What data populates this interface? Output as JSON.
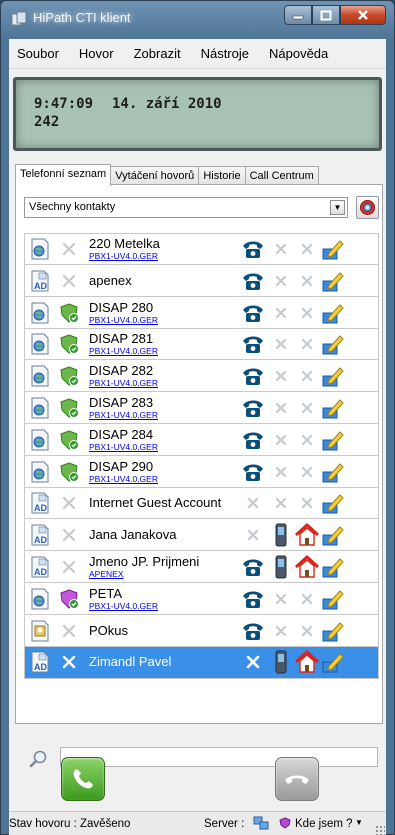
{
  "window": {
    "title": "HiPath CTI klient"
  },
  "menu": [
    "Soubor",
    "Hovor",
    "Zobrazit",
    "Nástroje",
    "Nápověda"
  ],
  "lcd": {
    "time": "9:47:09",
    "date": "14. září 2010",
    "extension": "242"
  },
  "tabs": [
    {
      "label": "Telefonní seznam",
      "active": true
    },
    {
      "label": "Vytáčení hovorů",
      "active": false
    },
    {
      "label": "Historie",
      "active": false
    },
    {
      "label": "Call Centrum",
      "active": false
    }
  ],
  "filter": {
    "selected": "Všechny kontakty"
  },
  "contacts": [
    {
      "name": "220 Metelka",
      "sub": "PBX1-UV4.0.GER",
      "type": "phonebook",
      "presence": "none",
      "actions": [
        "phone",
        "x",
        "x",
        "edit"
      ]
    },
    {
      "name": "apenex",
      "sub": "",
      "type": "ad",
      "presence": "none",
      "actions": [
        "phone",
        "x",
        "x",
        "edit"
      ]
    },
    {
      "name": "DISAP 280",
      "sub": "PBX1-UV4.0.GER",
      "type": "phonebook",
      "presence": "green",
      "actions": [
        "phone",
        "x",
        "x",
        "edit"
      ]
    },
    {
      "name": "DISAP 281",
      "sub": "PBX1-UV4.0.GER",
      "type": "phonebook",
      "presence": "green",
      "actions": [
        "phone",
        "x",
        "x",
        "edit"
      ]
    },
    {
      "name": "DISAP 282",
      "sub": "PBX1-UV4.0.GER",
      "type": "phonebook",
      "presence": "green",
      "actions": [
        "phone",
        "x",
        "x",
        "edit"
      ]
    },
    {
      "name": "DISAP 283",
      "sub": "PBX1-UV4.0.GER",
      "type": "phonebook",
      "presence": "green",
      "actions": [
        "phone",
        "x",
        "x",
        "edit"
      ]
    },
    {
      "name": "DISAP 284",
      "sub": "PBX1-UV4.0.GER",
      "type": "phonebook",
      "presence": "green",
      "actions": [
        "phone",
        "x",
        "x",
        "edit"
      ]
    },
    {
      "name": "DISAP 290",
      "sub": "PBX1-UV4.0.GER",
      "type": "phonebook",
      "presence": "green",
      "actions": [
        "phone",
        "x",
        "x",
        "edit"
      ]
    },
    {
      "name": "Internet Guest Account",
      "sub": "",
      "type": "ad",
      "presence": "none",
      "actions": [
        "x",
        "x",
        "x",
        "edit"
      ]
    },
    {
      "name": "Jana Janakova",
      "sub": "",
      "type": "ad",
      "presence": "none",
      "actions": [
        "x",
        "mobile",
        "home",
        "edit"
      ]
    },
    {
      "name": "Jmeno JP. Prijmeni",
      "sub": "APENEX",
      "type": "ad",
      "presence": "none",
      "actions": [
        "phone",
        "mobile",
        "home",
        "edit"
      ]
    },
    {
      "name": "PETA",
      "sub": "PBX1-UV4.0.GER",
      "type": "phonebook",
      "presence": "purple",
      "actions": [
        "phone",
        "x",
        "x",
        "edit"
      ]
    },
    {
      "name": "POkus",
      "sub": "",
      "type": "personal",
      "presence": "none",
      "actions": [
        "phone",
        "x",
        "x",
        "edit"
      ]
    },
    {
      "name": "Zimandl Pavel",
      "sub": "",
      "type": "ad",
      "presence": "none",
      "actions": [
        "x",
        "mobile",
        "home",
        "edit"
      ],
      "selected": true
    }
  ],
  "search": {
    "value": "",
    "placeholder": ""
  },
  "status": {
    "call_state": "Stav hovoru : Zavěšeno",
    "server_label": "Server :",
    "where_label": "Kde jsem ?",
    "where_arrow": "▼"
  },
  "colors": {
    "selection": "#3a8fe6",
    "link": "#0000ee",
    "lcd": "#a9c2b6"
  }
}
